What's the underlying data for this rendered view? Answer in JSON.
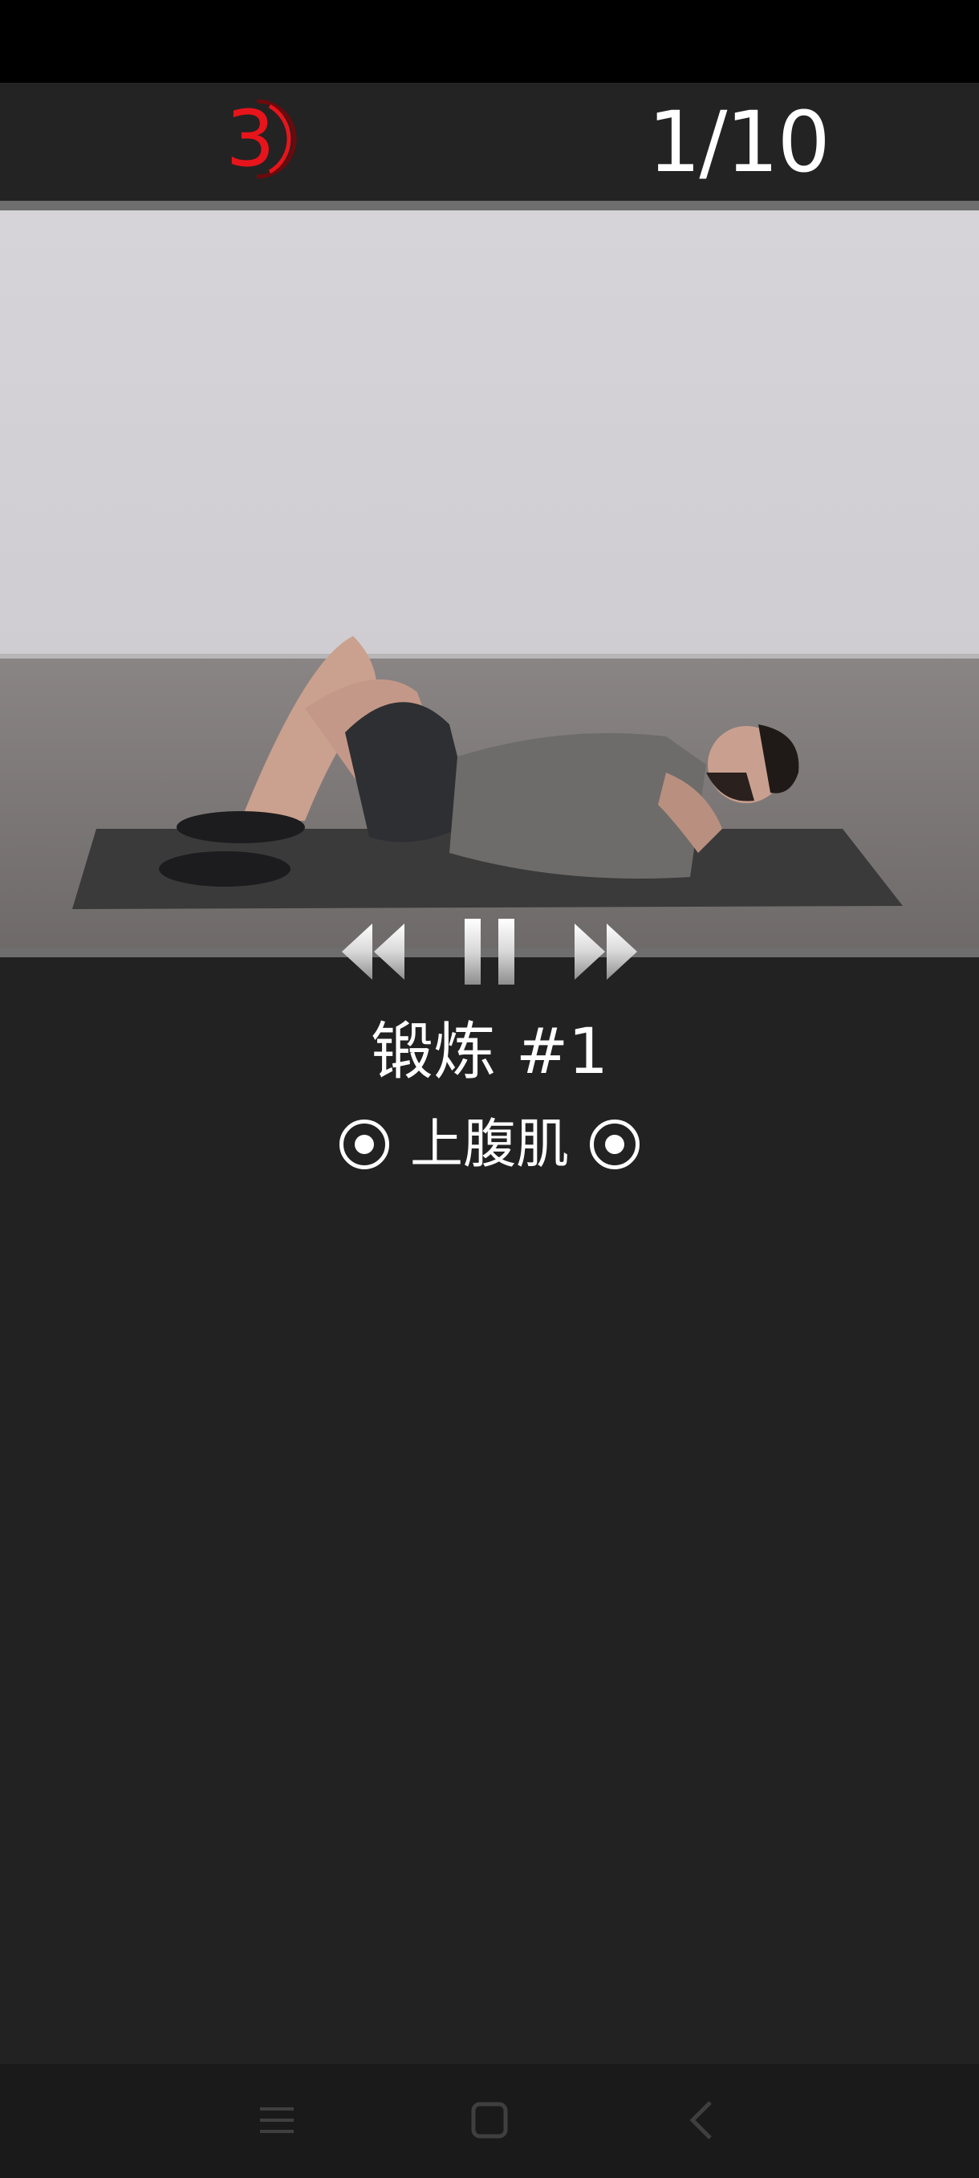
{
  "header": {
    "countdown": "3",
    "progress": "1/10",
    "countdown_color": "#e8141b"
  },
  "video": {
    "controls": {
      "rewind_icon": "rewind-icon",
      "pause_icon": "pause-icon",
      "forward_icon": "fast-forward-icon"
    }
  },
  "exercise": {
    "title": "锻炼 #1",
    "muscle": "上腹肌",
    "muscle_icon": "target-icon"
  },
  "navigation": {
    "menu_icon": "menu-icon",
    "home_icon": "home-icon",
    "back_icon": "back-icon"
  }
}
